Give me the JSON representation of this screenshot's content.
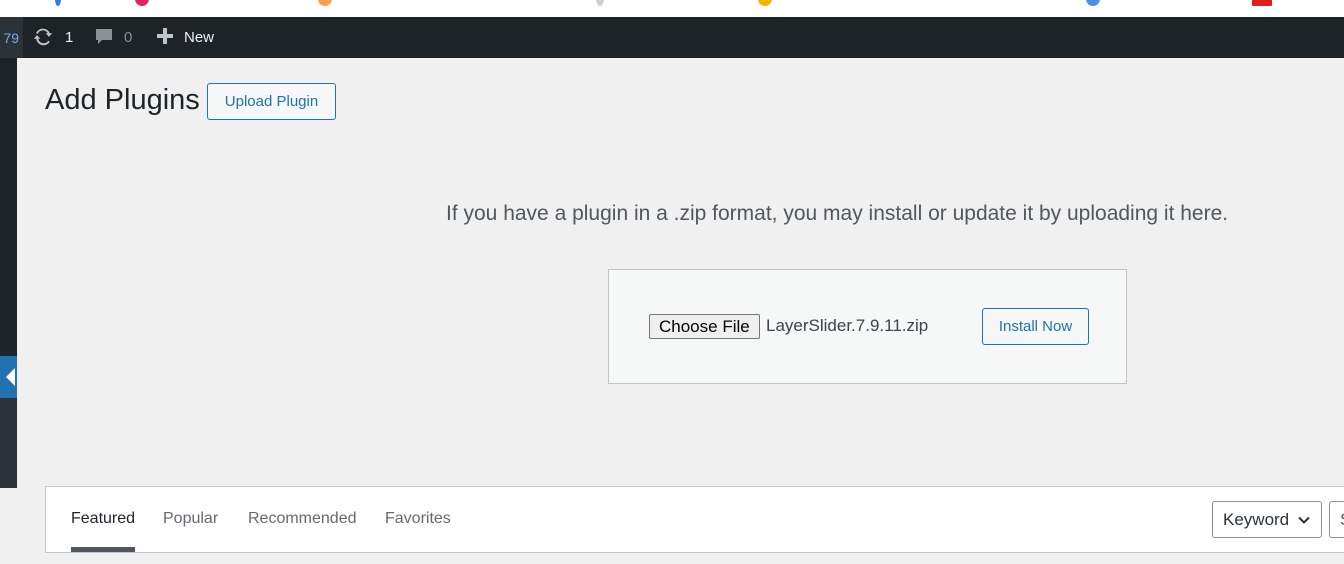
{
  "admin_bar": {
    "left_number": "79",
    "updates_count": "1",
    "comments_count": "0",
    "new_label": "New",
    "updates_icon": "refresh-icon",
    "comments_icon": "speech-bubble-icon",
    "new_icon": "plus-icon"
  },
  "page": {
    "title": "Add Plugins",
    "upload_button_label": "Upload Plugin",
    "upload_help": "If you have a plugin in a .zip format, you may install or update it by uploading it here."
  },
  "upload_form": {
    "choose_file_label": "Choose File",
    "selected_file": "LayerSlider.7.9.11.zip",
    "install_button_label": "Install Now"
  },
  "filter": {
    "tabs": [
      {
        "label": "Featured",
        "current": true
      },
      {
        "label": "Popular",
        "current": false
      },
      {
        "label": "Recommended",
        "current": false
      },
      {
        "label": "Favorites",
        "current": false
      }
    ],
    "search_type": "Keyword",
    "search_value": "S"
  },
  "colors": {
    "admin_bar_bg": "#1d2327",
    "accent": "#2271b1",
    "page_bg": "#f0f0f1"
  }
}
